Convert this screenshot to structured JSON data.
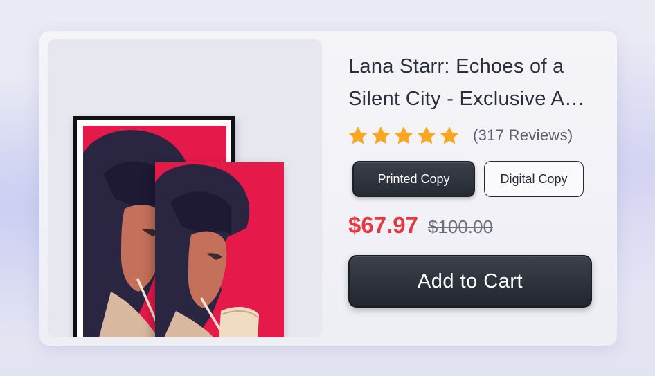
{
  "product": {
    "title": "Lana Starr: Echoes of a Silent City - Exclusive Art Print",
    "rating": 5,
    "rating_max": 5,
    "reviews_label": "(317 Reviews)",
    "star_color": "#f7a823",
    "image": {
      "description_icon": "portrait-artwork",
      "accent_color": "#e5194a"
    }
  },
  "format_options": [
    {
      "label": "Printed Copy",
      "selected": true
    },
    {
      "label": "Digital Copy",
      "selected": false
    }
  ],
  "pricing": {
    "sale_price": "$67.97",
    "original_price": "$100.00",
    "sale_color": "#e5393f"
  },
  "actions": {
    "add_to_cart_label": "Add to Cart"
  }
}
